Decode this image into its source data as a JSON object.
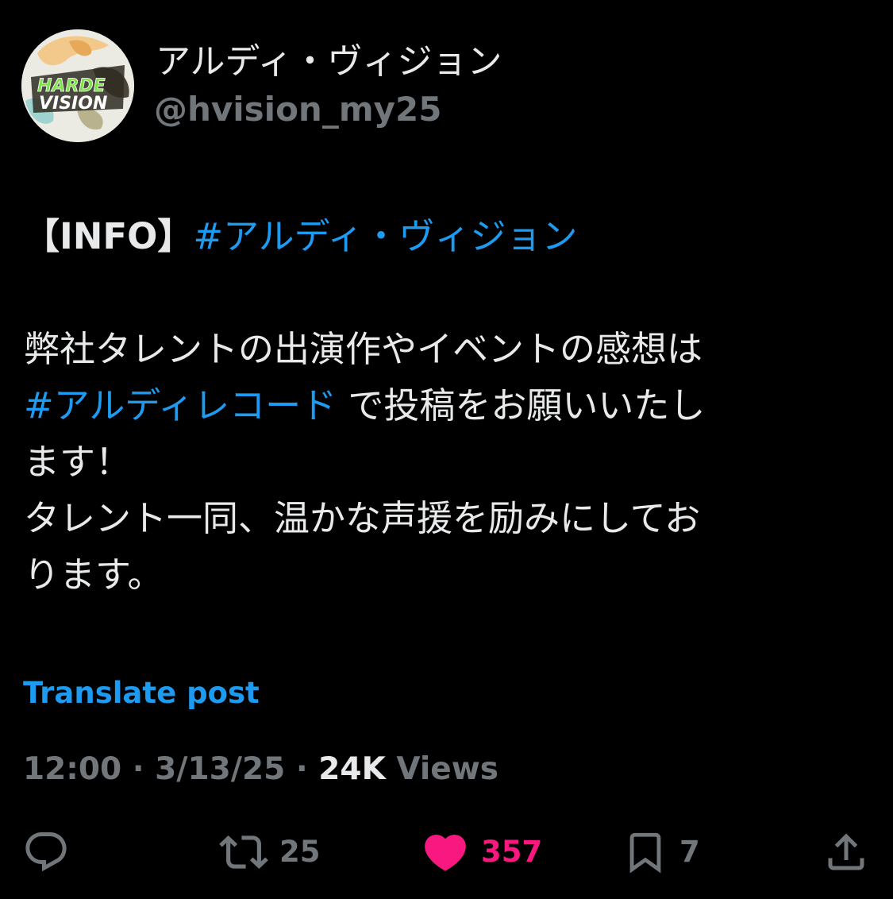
{
  "author": {
    "display_name": "アルディ・ヴィジョン",
    "handle": "@hvision_my25",
    "avatar_text": "HARDE VISION"
  },
  "post": {
    "line1_prefix": "【INFO】",
    "line1_hashtag": "#アルディ・ヴィジョン",
    "line2": "弊社タレントの出演作やイベントの感想は",
    "line3_hashtag": "#アルディレコード",
    "line3_suffix": " で投稿をお願いいたし",
    "line4": "ます！",
    "line5": "タレント一同、温かな声援を励みにしてお",
    "line6": "ります。"
  },
  "translate_label": "Translate post",
  "meta": {
    "time": "12:00",
    "separator": " · ",
    "date": "3/13/25",
    "views_count": "24K",
    "views_label": " Views"
  },
  "actions": {
    "reply_count": "",
    "repost_count": "25",
    "like_count": "357",
    "bookmark_count": "7"
  },
  "colors": {
    "background": "#000000",
    "text": "#e7e9ea",
    "secondary": "#71767b",
    "link": "#1d9bf0",
    "like": "#f91880"
  }
}
